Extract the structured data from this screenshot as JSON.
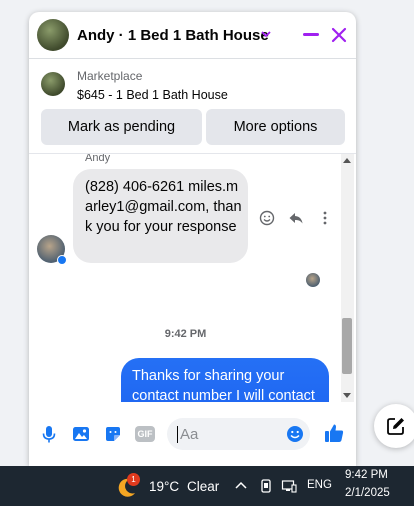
{
  "colors": {
    "accent": "#a020f0",
    "messenger_blue": "#1877f2",
    "outgoing_bubble": "#2570f5",
    "taskbar": "#1d2731"
  },
  "header": {
    "title": "Andy · 1 Bed 1 Bath House"
  },
  "listing": {
    "label": "Marketplace",
    "title": "$645 - 1 Bed 1 Bath House"
  },
  "actions": {
    "mark_pending": "Mark as pending",
    "more_options": "More options"
  },
  "messages": {
    "sender": "Andy",
    "incoming_text": "(828) 406-6261 miles.marley1@gmail.com, thank you for your response",
    "timestamp": "9:42 PM",
    "outgoing_text": "Thanks for sharing your contact number I will contact at your number as soon as possible"
  },
  "composer": {
    "placeholder": "Aa",
    "gif_label": "GIF"
  },
  "taskbar": {
    "weather_badge": "1",
    "temperature": "19°C",
    "condition": "Clear",
    "language": "ENG",
    "time": "9:42 PM",
    "date": "2/1/2025"
  }
}
